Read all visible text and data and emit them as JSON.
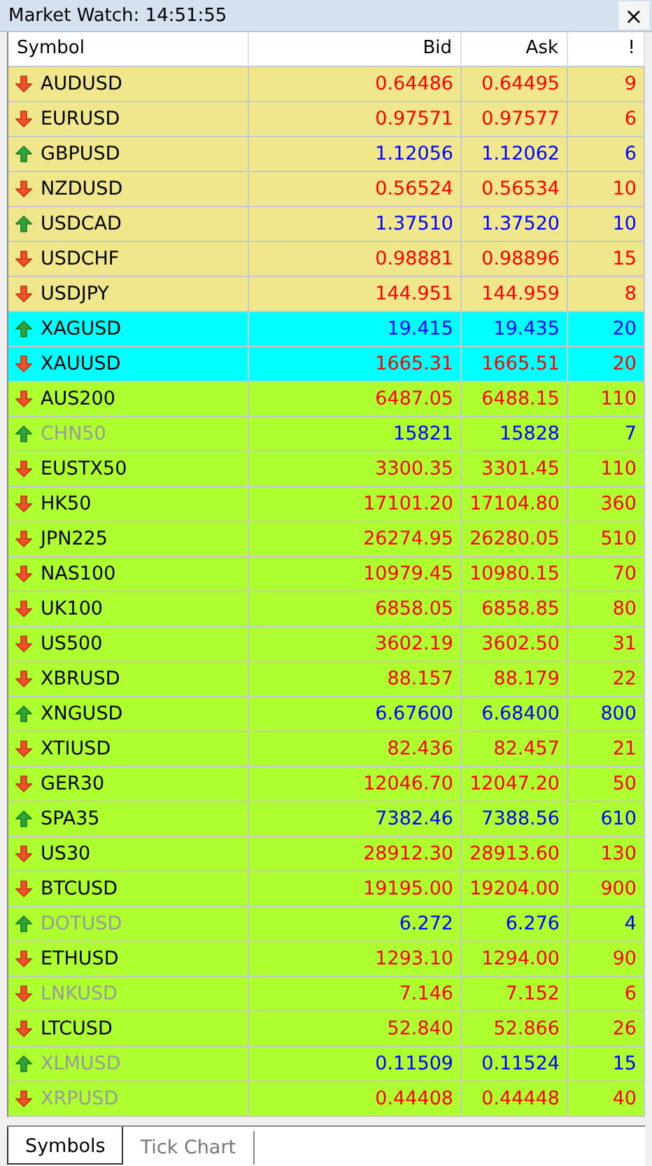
{
  "window": {
    "title": "Market Watch: 14:51:55",
    "close": "×"
  },
  "columns": [
    "Symbol",
    "Bid",
    "Ask",
    "!"
  ],
  "rows": [
    {
      "symbol": "AUDUSD",
      "bid": "0.64486",
      "ask": "0.64495",
      "spread": "9",
      "kind": "down",
      "dimmed": false,
      "color": "#f0e68c"
    },
    {
      "symbol": "EURUSD",
      "bid": "0.97571",
      "ask": "0.97577",
      "spread": "6",
      "kind": "down",
      "dimmed": false,
      "color": "#f0e68c"
    },
    {
      "symbol": "GBPUSD",
      "bid": "1.12056",
      "ask": "1.12062",
      "spread": "6",
      "kind": "up",
      "dimmed": false,
      "color": "#f0e68c"
    },
    {
      "symbol": "NZDUSD",
      "bid": "0.56524",
      "ask": "0.56534",
      "spread": "10",
      "kind": "down",
      "dimmed": false,
      "color": "#f0e68c"
    },
    {
      "symbol": "USDCAD",
      "bid": "1.37510",
      "ask": "1.37520",
      "spread": "10",
      "kind": "up",
      "dimmed": false,
      "color": "#f0e68c"
    },
    {
      "symbol": "USDCHF",
      "bid": "0.98881",
      "ask": "0.98896",
      "spread": "15",
      "kind": "down",
      "dimmed": false,
      "color": "#f0e68c"
    },
    {
      "symbol": "USDJPY",
      "bid": "144.951",
      "ask": "144.959",
      "spread": "8",
      "kind": "down",
      "dimmed": false,
      "color": "#f0e68c"
    },
    {
      "symbol": "XAGUSD",
      "bid": "19.415",
      "ask": "19.435",
      "spread": "20",
      "kind": "up",
      "dimmed": false,
      "color": "#00ffff"
    },
    {
      "symbol": "XAUUSD",
      "bid": "1665.31",
      "ask": "1665.51",
      "spread": "20",
      "kind": "down",
      "dimmed": false,
      "color": "#00ffff"
    },
    {
      "symbol": "AUS200",
      "bid": "6487.05",
      "ask": "6488.15",
      "spread": "110",
      "kind": "down",
      "dimmed": false,
      "color": "#adff2f"
    },
    {
      "symbol": "CHN50",
      "bid": "15821",
      "ask": "15828",
      "spread": "7",
      "kind": "up",
      "dimmed": true,
      "color": "#adff2f"
    },
    {
      "symbol": "EUSTX50",
      "bid": "3300.35",
      "ask": "3301.45",
      "spread": "110",
      "kind": "down",
      "dimmed": false,
      "color": "#adff2f"
    },
    {
      "symbol": "HK50",
      "bid": "17101.20",
      "ask": "17104.80",
      "spread": "360",
      "kind": "down",
      "dimmed": false,
      "color": "#adff2f"
    },
    {
      "symbol": "JPN225",
      "bid": "26274.95",
      "ask": "26280.05",
      "spread": "510",
      "kind": "down",
      "dimmed": false,
      "color": "#adff2f"
    },
    {
      "symbol": "NAS100",
      "bid": "10979.45",
      "ask": "10980.15",
      "spread": "70",
      "kind": "down",
      "dimmed": false,
      "color": "#adff2f"
    },
    {
      "symbol": "UK100",
      "bid": "6858.05",
      "ask": "6858.85",
      "spread": "80",
      "kind": "down",
      "dimmed": false,
      "color": "#adff2f"
    },
    {
      "symbol": "US500",
      "bid": "3602.19",
      "ask": "3602.50",
      "spread": "31",
      "kind": "down",
      "dimmed": false,
      "color": "#adff2f"
    },
    {
      "symbol": "XBRUSD",
      "bid": "88.157",
      "ask": "88.179",
      "spread": "22",
      "kind": "down",
      "dimmed": false,
      "color": "#adff2f"
    },
    {
      "symbol": "XNGUSD",
      "bid": "6.67600",
      "ask": "6.68400",
      "spread": "800",
      "kind": "up",
      "dimmed": false,
      "color": "#adff2f"
    },
    {
      "symbol": "XTIUSD",
      "bid": "82.436",
      "ask": "82.457",
      "spread": "21",
      "kind": "down",
      "dimmed": false,
      "color": "#adff2f"
    },
    {
      "symbol": "GER30",
      "bid": "12046.70",
      "ask": "12047.20",
      "spread": "50",
      "kind": "down",
      "dimmed": false,
      "color": "#adff2f"
    },
    {
      "symbol": "SPA35",
      "bid": "7382.46",
      "ask": "7388.56",
      "spread": "610",
      "kind": "up",
      "dimmed": false,
      "color": "#adff2f"
    },
    {
      "symbol": "US30",
      "bid": "28912.30",
      "ask": "28913.60",
      "spread": "130",
      "kind": "down",
      "dimmed": false,
      "color": "#adff2f"
    },
    {
      "symbol": "BTCUSD",
      "bid": "19195.00",
      "ask": "19204.00",
      "spread": "900",
      "kind": "down",
      "dimmed": false,
      "color": "#adff2f"
    },
    {
      "symbol": "DOTUSD",
      "bid": "6.272",
      "ask": "6.276",
      "spread": "4",
      "kind": "up",
      "dimmed": true,
      "color": "#adff2f"
    },
    {
      "symbol": "ETHUSD",
      "bid": "1293.10",
      "ask": "1294.00",
      "spread": "90",
      "kind": "down",
      "dimmed": false,
      "color": "#adff2f"
    },
    {
      "symbol": "LNKUSD",
      "bid": "7.146",
      "ask": "7.152",
      "spread": "6",
      "kind": "down",
      "dimmed": true,
      "color": "#adff2f"
    },
    {
      "symbol": "LTCUSD",
      "bid": "52.840",
      "ask": "52.866",
      "spread": "26",
      "kind": "down",
      "dimmed": false,
      "color": "#adff2f"
    },
    {
      "symbol": "XLMUSD",
      "bid": "0.11509",
      "ask": "0.11524",
      "spread": "15",
      "kind": "up",
      "dimmed": true,
      "color": "#adff2f"
    },
    {
      "symbol": "XRPUSD",
      "bid": "0.44408",
      "ask": "0.44448",
      "spread": "40",
      "kind": "down",
      "dimmed": true,
      "color": "#adff2f"
    }
  ],
  "tabs": [
    {
      "label": "Symbols",
      "selected": true
    },
    {
      "label": "Tick Chart",
      "selected": false
    }
  ]
}
